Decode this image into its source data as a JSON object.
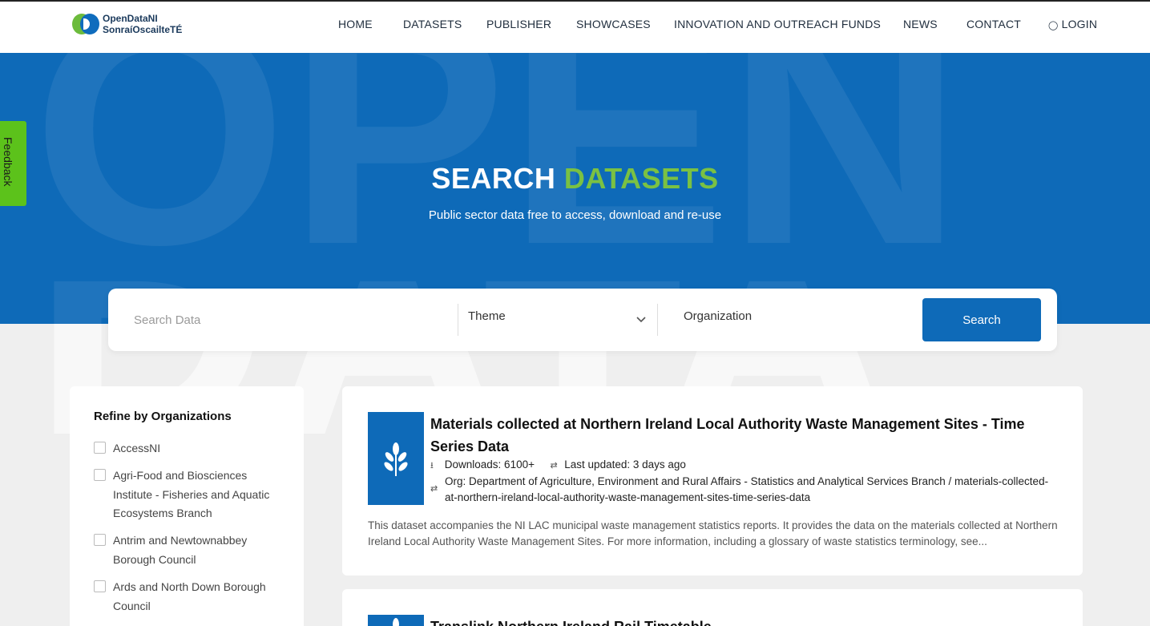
{
  "brand": {
    "line1": "OpenDataNI",
    "line2": "SonraíOscailteTÉ"
  },
  "nav": {
    "items": [
      "HOME",
      "DATASETS",
      "PUBLISHER",
      "SHOWCASES",
      "INNOVATION AND OUTREACH FUNDS",
      "NEWS",
      "CONTACT"
    ],
    "login": "LOGIN"
  },
  "hero": {
    "title_white": "SEARCH",
    "title_green": "DATASETS",
    "subtitle": "Public sector data free to access, download and re-use"
  },
  "feedback": {
    "label": "Feedback"
  },
  "search": {
    "placeholder": "Search Data",
    "theme_label": "Theme",
    "organization_label": "Organization",
    "button_label": "Search"
  },
  "sidebar": {
    "heading": "Refine by Organizations",
    "items": [
      {
        "label": "AccessNI"
      },
      {
        "label": "Agri-Food and Biosciences Institute - Fisheries and Aquatic Ecosystems Branch"
      },
      {
        "label": "Antrim and Newtownabbey Borough Council"
      },
      {
        "label": "Ards and North Down Borough Council"
      }
    ]
  },
  "results": [
    {
      "title": "Materials collected at Northern Ireland Local Authority Waste Management Sites - Time Series Data",
      "downloads": "Downloads: 6100+",
      "updated": "Last updated: 3 days ago",
      "org": "Org: Department of Agriculture, Environment and Rural Affairs - Statistics and Analytical Services Branch / materials-collected-at-northern-ireland-local-authority-waste-management-sites-time-series-data",
      "description": "This dataset accompanies the NI LAC municipal waste management statistics reports. It provides the data on the materials collected at Northern Ireland Local Authority Waste Management Sites. For more information, including a glossary of waste statistics terminology, see..."
    },
    {
      "title": "Translink Northern Ireland Rail Timetable"
    }
  ],
  "colors": {
    "primary": "#0e6ab8",
    "accent": "#7ac143",
    "feedback": "#5cc21b"
  }
}
